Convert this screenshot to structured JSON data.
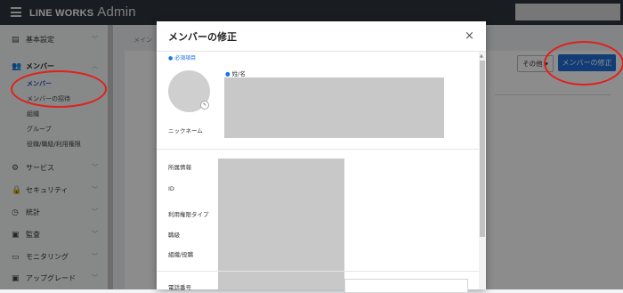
{
  "topbar": {
    "brand": "LINE WORKS",
    "brand_suffix": "Admin"
  },
  "sidebar": {
    "items": [
      {
        "icon": "document-settings-icon",
        "glyph": "▤",
        "label": "基本設定",
        "open": false
      },
      {
        "icon": "members-icon",
        "glyph": "👥",
        "label": "メンバー",
        "open": true
      },
      {
        "icon": "gear-icon",
        "glyph": "⚙",
        "label": "サービス",
        "open": false
      },
      {
        "icon": "lock-icon",
        "glyph": "🔒",
        "label": "セキュリティ",
        "open": false
      },
      {
        "icon": "clock-icon",
        "glyph": "◷",
        "label": "統計",
        "open": false
      },
      {
        "icon": "audit-icon",
        "glyph": "▣",
        "label": "監査",
        "open": false
      },
      {
        "icon": "monitor-icon",
        "glyph": "▭",
        "label": "モニタリング",
        "open": false
      },
      {
        "icon": "upgrade-icon",
        "glyph": "▣",
        "label": "アップグレード",
        "open": false
      }
    ],
    "sub_items": [
      {
        "label": "メンバー",
        "active": true
      },
      {
        "label": "メンバーの招待",
        "active": false
      },
      {
        "label": "組織",
        "active": false
      },
      {
        "label": "グループ",
        "active": false
      },
      {
        "label": "役職/職級/利用権限",
        "active": false
      }
    ]
  },
  "page": {
    "breadcrumb": "メイン",
    "other_button": "その他",
    "edit_member_button": "メンバーの修正"
  },
  "modal": {
    "title": "メンバーの修正",
    "close": "×",
    "required_note": "● 必須項目",
    "name_label": "姓/名",
    "nickname_label": "ニックネーム",
    "fields": [
      "所属情報",
      "ID",
      "利用権限タイプ",
      "職級",
      "組織/役職",
      "電話番号"
    ]
  },
  "annotations": {
    "color": "#e0201b"
  },
  "colors": {
    "accent": "#1f6ed6",
    "topbar": "#2f333b"
  }
}
